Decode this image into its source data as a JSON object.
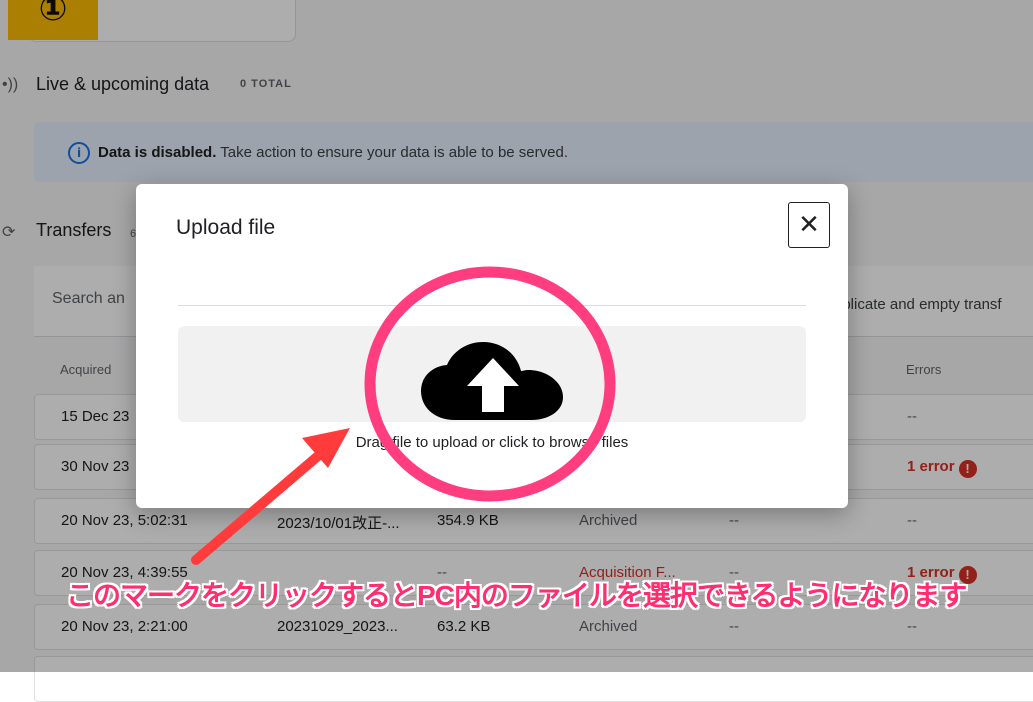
{
  "step_badge": "①",
  "live_section": {
    "icon": "broadcast-icon",
    "title": "Live & upcoming data",
    "total": "0 TOTAL"
  },
  "notice": {
    "bold": "Data is disabled.",
    "rest": " Take action to ensure your data is able to be served."
  },
  "transfers_section": {
    "title": "Transfers",
    "count_fragment": "6"
  },
  "search": {
    "placeholder": "Search an",
    "duplicate_text": "uplicate and empty transf"
  },
  "columns": {
    "acquired": "Acquired",
    "errors": "Errors"
  },
  "rows": [
    {
      "acquired": "15 Dec 23",
      "name": "",
      "size": "",
      "status": "",
      "extra": "",
      "errors": "--"
    },
    {
      "acquired": "30 Nov 23",
      "name": "",
      "size": "",
      "status": "",
      "extra": "",
      "errors": "1 error"
    },
    {
      "acquired": "20 Nov 23, 5:02:31",
      "name": "2023/10/01改正-...",
      "size": "354.9 KB",
      "status": "Archived",
      "extra": "--",
      "errors": "--"
    },
    {
      "acquired": "20 Nov 23, 4:39:55",
      "name": "",
      "size": "--",
      "status": "Acquisition F...",
      "extra": "--",
      "errors": "1 error"
    },
    {
      "acquired": "20 Nov 23, 2:21:00",
      "name": "20231029_2023...",
      "size": "63.2 KB",
      "status": "Archived",
      "extra": "--",
      "errors": "--"
    }
  ],
  "modal": {
    "title": "Upload file",
    "close_label": "✕",
    "dropzone_text": "Drag file to upload or click to browse files",
    "upload_icon": "cloud-upload-icon"
  },
  "annotation": {
    "caption": "このマークをクリックするとPC内のファイルを選択できるようになります",
    "highlight_color": "#ff3d7f",
    "arrow_color": "#ff3b3b"
  },
  "colors": {
    "error": "#d93025",
    "info": "#1a73e8",
    "badge": "#fbbc04"
  }
}
